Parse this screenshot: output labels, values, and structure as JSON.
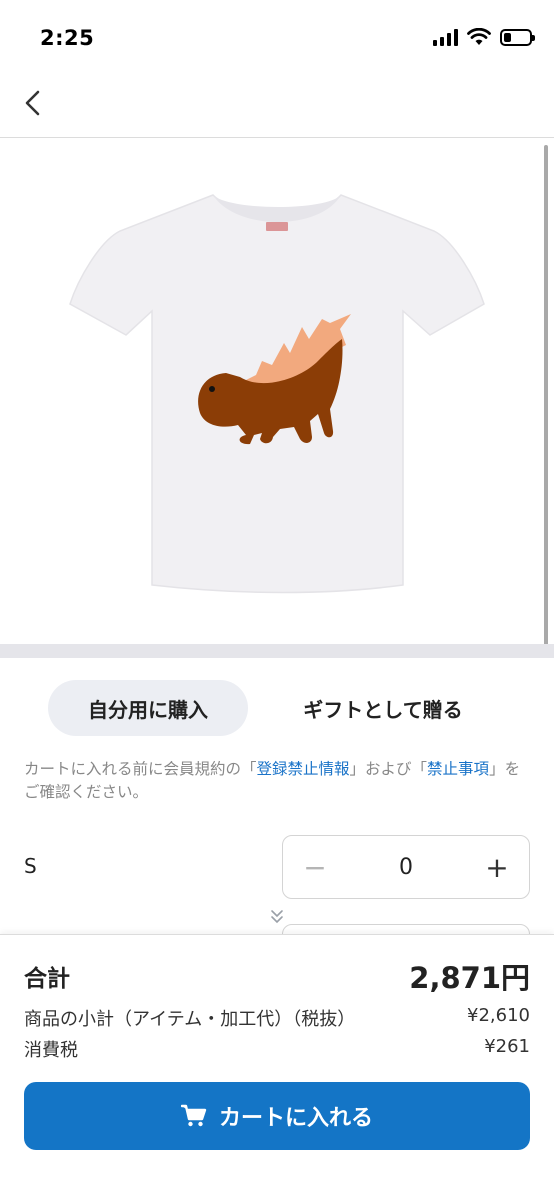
{
  "status_bar": {
    "time": "2:25",
    "battery_level": 0.3
  },
  "purchase_options": {
    "self": "自分用に購入",
    "gift": "ギフトとして贈る",
    "selected": "self"
  },
  "terms": {
    "part1": "カートに入れる前に会員規約の「",
    "link1": "登録禁止情報",
    "part2": "」および「",
    "link2": "禁止事項",
    "part3": "」をご確認ください。"
  },
  "size_row": {
    "size": "S",
    "quantity": "0",
    "minus": "−",
    "plus": "+"
  },
  "summary": {
    "total_label": "合計",
    "total_value": "2,871円",
    "subtotal_label": "商品の小計（アイテム・加工代）（税抜）",
    "subtotal_value": "¥2,610",
    "tax_label": "消費税",
    "tax_value": "¥261"
  },
  "cart_button": {
    "label": "カートに入れる"
  },
  "colors": {
    "accent": "#1475c6",
    "link": "#1a73c8",
    "toggle_selected_bg": "#eceef3",
    "creature_body": "#8b3d06",
    "creature_spikes": "#f2a97e",
    "shirt": "#f1f0f3"
  },
  "icons": [
    "back-chevron-icon",
    "signal-icon",
    "wifi-icon",
    "battery-icon",
    "expand-down-icon",
    "cart-icon"
  ]
}
